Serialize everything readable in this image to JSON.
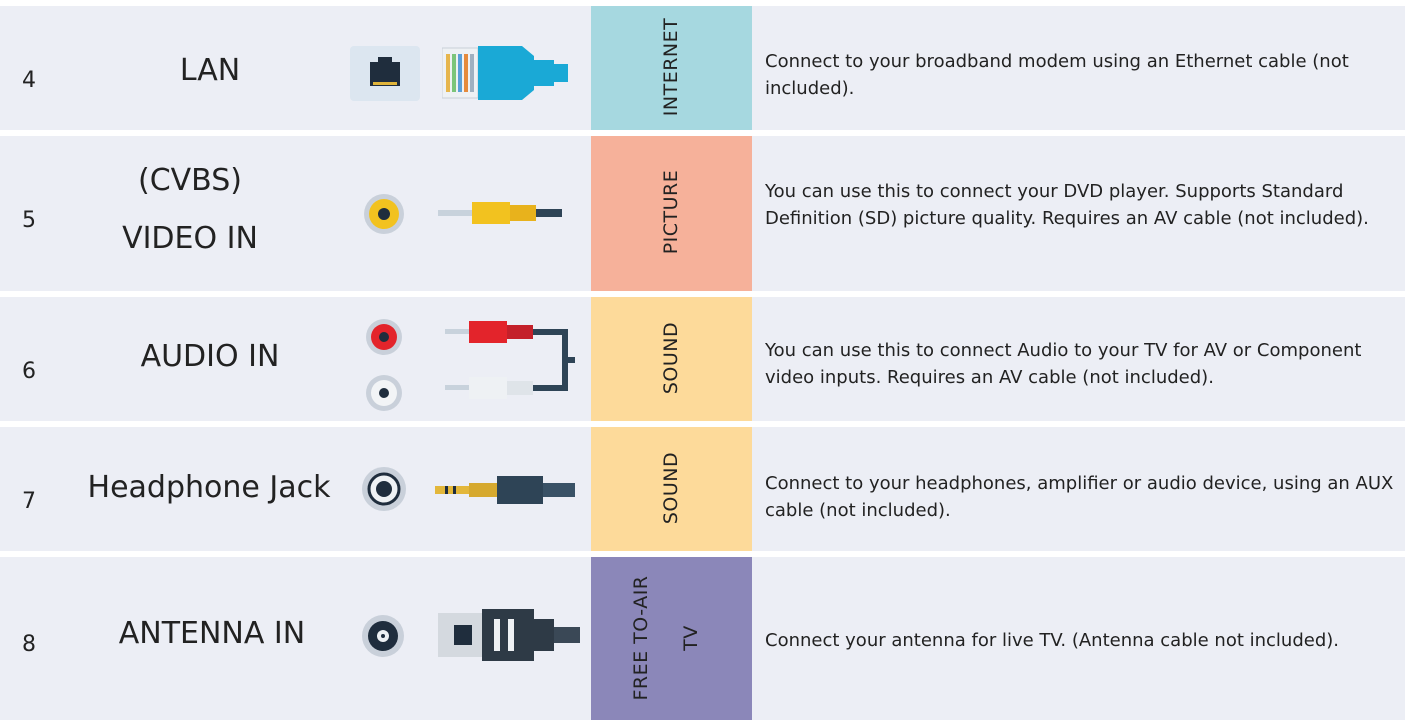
{
  "rows": [
    {
      "number": "4",
      "name": "LAN",
      "category": "INTERNET",
      "category_color": "#a6d8e0",
      "description": "Connect to your broadband modem using an Ethernet cable (not included).",
      "port_icon": "ethernet-port-icon",
      "cable_icon": "ethernet-cable-icon"
    },
    {
      "number": "5",
      "name_lines": [
        "(CVBS)",
        "VIDEO IN"
      ],
      "category": "PICTURE",
      "category_color": "#f6b19a",
      "description": "You can use this to connect your DVD player. Supports Standard Definition (SD) picture quality. Requires an AV cable (not included).",
      "port_icon": "yellow-rca-port-icon",
      "cable_icon": "yellow-rca-cable-icon"
    },
    {
      "number": "6",
      "name": "AUDIO IN",
      "category": "SOUND",
      "category_color": "#fdda9a",
      "description": "You can use this to connect Audio to your TV for AV or Component video inputs. Requires an AV cable (not included).",
      "port_icon": "red-white-rca-ports-icon",
      "cable_icon": "red-white-rca-cable-icon"
    },
    {
      "number": "7",
      "name": "Headphone Jack",
      "category": "SOUND",
      "category_color": "#fdda9a",
      "description": "Connect to your headphones, amplifier or audio device, using an AUX cable (not included).",
      "port_icon": "headphone-port-icon",
      "cable_icon": "aux-cable-icon"
    },
    {
      "number": "8",
      "name": "ANTENNA IN",
      "category_lines": [
        "FREE TO-AIR",
        "TV"
      ],
      "category_color": "#8b87b9",
      "description": "Connect your antenna for live TV. (Antenna cable not included).",
      "port_icon": "antenna-port-icon",
      "cable_icon": "antenna-cable-icon"
    }
  ]
}
